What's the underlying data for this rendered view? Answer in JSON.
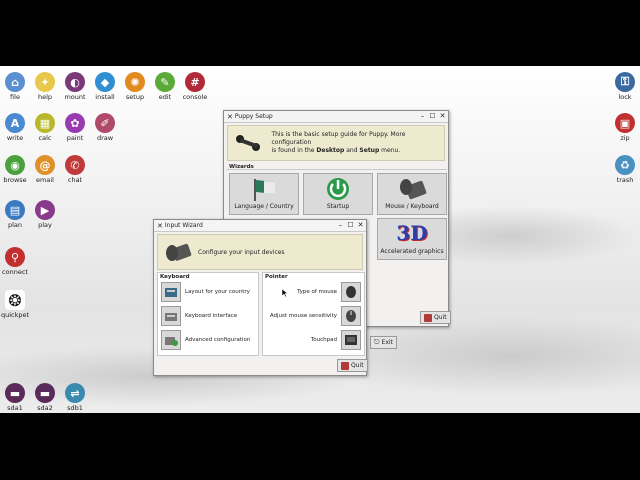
{
  "desktop_icons": [
    {
      "label": "file",
      "icon": "home-icon",
      "color": "#5a8fd0"
    },
    {
      "label": "help",
      "icon": "lightbulb-icon",
      "color": "#e8c84a"
    },
    {
      "label": "mount",
      "icon": "toggle-icon",
      "color": "#7a3a7a"
    },
    {
      "label": "install",
      "icon": "dropbox-icon",
      "color": "#2f8fd0"
    },
    {
      "label": "setup",
      "icon": "gear-icon",
      "color": "#e08a20"
    },
    {
      "label": "edit",
      "icon": "edit-icon",
      "color": "#5aaa3a"
    },
    {
      "label": "console",
      "icon": "console-icon",
      "color": "#b02a3a"
    },
    {
      "label": "write",
      "icon": "write-icon",
      "color": "#4a8ad0"
    },
    {
      "label": "calc",
      "icon": "calc-icon",
      "color": "#b8b82a"
    },
    {
      "label": "paint",
      "icon": "paint-icon",
      "color": "#9a3ab0"
    },
    {
      "label": "draw",
      "icon": "draw-icon",
      "color": "#b04a6a"
    },
    {
      "label": "browse",
      "icon": "browse-icon",
      "color": "#4aa03a"
    },
    {
      "label": "email",
      "icon": "at-icon",
      "color": "#e0902a"
    },
    {
      "label": "chat",
      "icon": "chat-icon",
      "color": "#c03a3a"
    },
    {
      "label": "plan",
      "icon": "calendar-icon",
      "color": "#3a7ac0"
    },
    {
      "label": "play",
      "icon": "film-icon",
      "color": "#8a3a8a"
    },
    {
      "label": "connect",
      "icon": "connect-icon",
      "color": "#c03030"
    },
    {
      "label": "quickpet",
      "icon": "paw-icon",
      "color": "#222222"
    },
    {
      "label": "lock",
      "icon": "lock-icon",
      "color": "#3a6aa0"
    },
    {
      "label": "zip",
      "icon": "zip-icon",
      "color": "#c03030"
    },
    {
      "label": "trash",
      "icon": "trash-icon",
      "color": "#4a90c0"
    },
    {
      "label": "sda1",
      "icon": "drive-icon",
      "color": "#5a2a5a"
    },
    {
      "label": "sda2",
      "icon": "drive-icon",
      "color": "#5a2a5a"
    },
    {
      "label": "sdb1",
      "icon": "usb-icon",
      "color": "#3a8ab0"
    }
  ],
  "setup": {
    "title": "Puppy Setup",
    "intro_1": "This is the basic setup guide for Puppy. More configuration",
    "intro_2a": "is found in the ",
    "intro_desktop": "Desktop",
    "intro_and": " and ",
    "intro_setup": "Setup",
    "intro_2b": " menu.",
    "wizards_label": "Wizards",
    "tiles": [
      "Language / Country",
      "Startup",
      "Mouse / Keyboard",
      "Accelerated graphics"
    ],
    "exit": "Exit",
    "quit": "Quit"
  },
  "input": {
    "title": "Input Wizard",
    "banner": "Configure your input devices",
    "keyboard_label": "Keyboard",
    "pointer_label": "Pointer",
    "keyboard_items": [
      "Layout for your country",
      "Keyboard interface",
      "Advanced configuration"
    ],
    "pointer_items": [
      "Type of mouse",
      "Adjust mouse sensitivity",
      "Touchpad"
    ],
    "quit": "Quit"
  }
}
